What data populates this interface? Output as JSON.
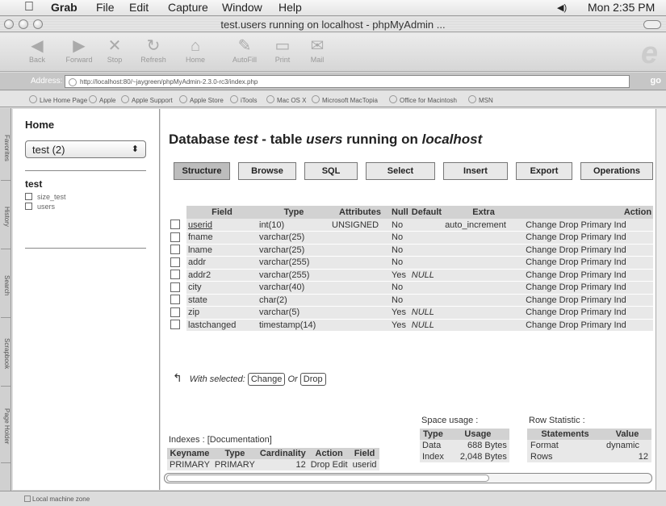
{
  "menubar": {
    "app": "Grab",
    "items": [
      "File",
      "Edit",
      "Capture",
      "Window",
      "Help"
    ],
    "clock": "Mon 2:35 PM",
    "volume": "◀)"
  },
  "window": {
    "title": "test.users running on localhost - phpMyAdmin ..."
  },
  "toolbar": {
    "back": "Back",
    "forward": "Forward",
    "stop": "Stop",
    "refresh": "Refresh",
    "home": "Home",
    "autofill": "AutoFill",
    "print": "Print",
    "mail": "Mail"
  },
  "address": {
    "label": "Address:",
    "url": "http://localhost:80/~jaygreen/phpMyAdmin-2.3.0-rc3/index.php",
    "go": "go"
  },
  "favorites": [
    "Live Home Page",
    "Apple",
    "Apple Support",
    "Apple Store",
    "iTools",
    "Mac OS X",
    "Microsoft MacTopia",
    "Office for Macintosh",
    "MSN"
  ],
  "sidetabs": [
    "Favorites",
    "History",
    "Search",
    "Scrapbook",
    "Page Holder"
  ],
  "nav": {
    "home": "Home",
    "db_select": "test (2)",
    "db_name": "test",
    "tables": [
      "size_test",
      "users"
    ]
  },
  "main": {
    "heading": {
      "p1": "Database ",
      "db": "test",
      "p2": " - table ",
      "tbl": "users",
      "p3": " running on ",
      "host": "localhost"
    },
    "tabs": [
      "Structure",
      "Browse",
      "SQL",
      "Select",
      "Insert",
      "Export",
      "Operations"
    ],
    "columns": [
      "Field",
      "Type",
      "Attributes",
      "Null",
      "Default",
      "Extra",
      "Action"
    ],
    "rows": [
      {
        "field": "userid",
        "type": "int(10)",
        "attr": "UNSIGNED",
        "null": "No",
        "default": "",
        "extra": "auto_increment",
        "action": "Change Drop Primary Ind"
      },
      {
        "field": "fname",
        "type": "varchar(25)",
        "attr": "",
        "null": "No",
        "default": "",
        "extra": "",
        "action": "Change Drop Primary Ind"
      },
      {
        "field": "lname",
        "type": "varchar(25)",
        "attr": "",
        "null": "No",
        "default": "",
        "extra": "",
        "action": "Change Drop Primary Ind"
      },
      {
        "field": "addr",
        "type": "varchar(255)",
        "attr": "",
        "null": "No",
        "default": "",
        "extra": "",
        "action": "Change Drop Primary Ind"
      },
      {
        "field": "addr2",
        "type": "varchar(255)",
        "attr": "",
        "null": "Yes",
        "default": "NULL",
        "extra": "",
        "action": "Change Drop Primary Ind"
      },
      {
        "field": "city",
        "type": "varchar(40)",
        "attr": "",
        "null": "No",
        "default": "",
        "extra": "",
        "action": "Change Drop Primary Ind"
      },
      {
        "field": "state",
        "type": "char(2)",
        "attr": "",
        "null": "No",
        "default": "",
        "extra": "",
        "action": "Change Drop Primary Ind"
      },
      {
        "field": "zip",
        "type": "varchar(5)",
        "attr": "",
        "null": "Yes",
        "default": "NULL",
        "extra": "",
        "action": "Change Drop Primary Ind"
      },
      {
        "field": "lastchanged",
        "type": "timestamp(14)",
        "attr": "",
        "null": "Yes",
        "default": "NULL",
        "extra": "",
        "action": "Change Drop Primary Ind"
      }
    ],
    "with_selected": "With selected:",
    "change_btn": "Change",
    "or": "Or",
    "drop_btn": "Drop",
    "indexes_label": "Indexes : [Documentation]",
    "index_columns": [
      "Keyname",
      "Type",
      "Cardinality",
      "Action",
      "Field"
    ],
    "index_row": {
      "keyname": "PRIMARY",
      "type": "PRIMARY",
      "cardinality": "12",
      "action": "Drop Edit",
      "field": "userid"
    },
    "space_label": "Space usage :",
    "space_columns": [
      "Type",
      "Usage"
    ],
    "space_rows": [
      {
        "type": "Data",
        "usage": "688 Bytes"
      },
      {
        "type": "Index",
        "usage": "2,048 Bytes"
      }
    ],
    "row_label": "Row Statistic :",
    "row_columns": [
      "Statements",
      "Value"
    ],
    "row_rows": [
      {
        "stmt": "Format",
        "value": "dynamic"
      },
      {
        "stmt": "Rows",
        "value": "12"
      }
    ]
  },
  "status": "Local machine zone"
}
